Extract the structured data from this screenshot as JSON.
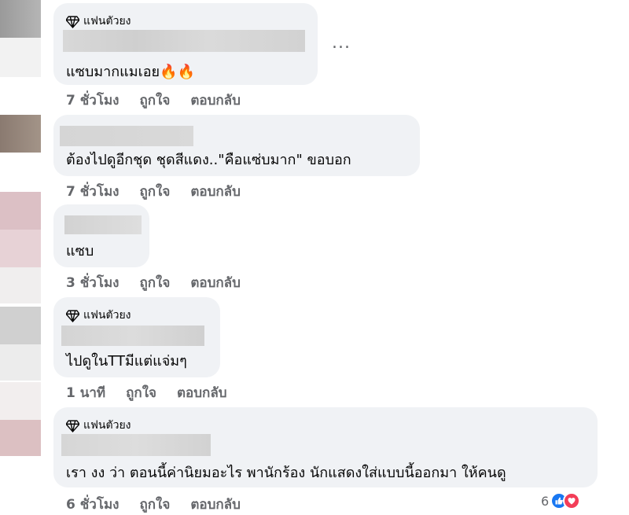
{
  "comments": [
    {
      "badge": "แฟนตัวยง",
      "text": "แซบมากแมเอย",
      "emoji": "🔥🔥",
      "time": "7 ชั่วโมง",
      "like": "ถูกใจ",
      "reply": "ตอบกลับ"
    },
    {
      "badge": "",
      "text": "ต้องไปดูอีกชุด ชุดสีแดง..\"คือแซ่บมาก\" ขอบอก",
      "time": "7 ชั่วโมง",
      "like": "ถูกใจ",
      "reply": "ตอบกลับ"
    },
    {
      "badge": "",
      "text": "แซบ",
      "time": "3 ชั่วโมง",
      "like": "ถูกใจ",
      "reply": "ตอบกลับ"
    },
    {
      "badge": "แฟนตัวยง",
      "text": "ไปดูในTTมีแต่แจ่มๆ",
      "time": "1 นาที",
      "like": "ถูกใจ",
      "reply": "ตอบกลับ"
    },
    {
      "badge": "แฟนตัวยง",
      "text": "เรา งง ว่า ตอนนี้ค่านิยมอะไร พานักร้อง นักแสดงใส่แบบนี้ออกมา ให้คนดู",
      "time": "6 ชั่วโมง",
      "like": "ถูกใจ",
      "reply": "ตอบกลับ"
    }
  ],
  "more_options": "...",
  "reaction_count": "6",
  "icons": {
    "badge": "diamond-icon",
    "like_reaction": "thumbs-up-icon",
    "love_reaction": "heart-icon"
  },
  "colors": {
    "bubble": "#f0f2f5",
    "meta_text": "#65676b",
    "like_blue": "#1877f2",
    "love_red": "#f33e58"
  }
}
